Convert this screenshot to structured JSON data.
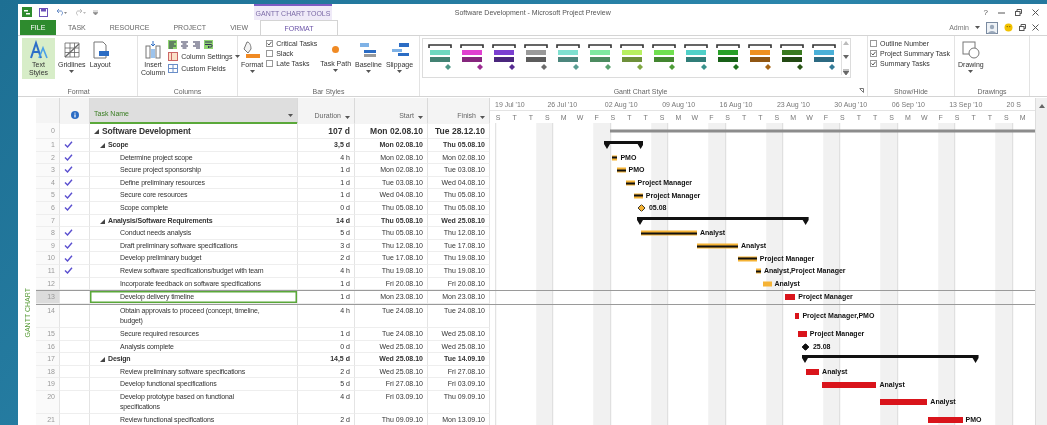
{
  "title_bar": {
    "context_label": "GANTT CHART TOOLS",
    "title": "Software Development - Microsoft Project Preview",
    "help": "?"
  },
  "tabs": [
    {
      "label": "FILE",
      "kind": "file",
      "selected": false
    },
    {
      "label": "TASK",
      "kind": "tab",
      "selected": false
    },
    {
      "label": "RESOURCE",
      "kind": "tab",
      "selected": false
    },
    {
      "label": "PROJECT",
      "kind": "tab",
      "selected": false
    },
    {
      "label": "VIEW",
      "kind": "tab",
      "selected": false
    },
    {
      "label": "FORMAT",
      "kind": "tab",
      "selected": true
    }
  ],
  "account": {
    "user": "Admin"
  },
  "ribbon": [
    {
      "label": "Format",
      "items": [
        {
          "kind": "large",
          "label": "Text Styles",
          "selected": true,
          "dropdown": false
        },
        {
          "kind": "large",
          "label": "Gridlines",
          "selected": false,
          "dropdown": true
        },
        {
          "kind": "large",
          "label": "Layout",
          "selected": false,
          "dropdown": false
        }
      ]
    },
    {
      "label": "Columns",
      "items": [
        {
          "kind": "large",
          "label": "Insert Column",
          "selected": false,
          "dropdown": false
        },
        {
          "kind": "tools",
          "tools": [
            {
              "kind": "align-left",
              "selected": true
            },
            {
              "kind": "align-center",
              "selected": false
            },
            {
              "kind": "align-right",
              "selected": false
            },
            {
              "kind": "wrap",
              "selected": true
            }
          ]
        },
        {
          "kind": "small",
          "label": "Column Settings",
          "dropdown": true
        },
        {
          "kind": "small",
          "label": "Custom Fields",
          "dropdown": false
        }
      ]
    },
    {
      "label": "Bar Styles",
      "items": [
        {
          "kind": "large",
          "label": "Format",
          "selected": false,
          "dropdown": true
        },
        {
          "kind": "check",
          "label": "Critical Tasks",
          "checked": true
        },
        {
          "kind": "check",
          "label": "Slack",
          "checked": false
        },
        {
          "kind": "check",
          "label": "Late Tasks",
          "checked": false
        },
        {
          "kind": "large",
          "label": "Task Path",
          "selected": false,
          "dropdown": true
        },
        {
          "kind": "large",
          "label": "Baseline",
          "selected": false,
          "dropdown": true
        },
        {
          "kind": "large",
          "label": "Slippage",
          "selected": false,
          "dropdown": true
        }
      ]
    },
    {
      "label": "Gantt Chart Style",
      "launcher": true,
      "items": [
        {
          "kind": "gallery",
          "styles": [
            {
              "color": "#6fd8c0"
            },
            {
              "color": "#e040d0"
            },
            {
              "color": "#7b3fd0"
            },
            {
              "color": "#9a9a9a"
            },
            {
              "color": "#7fe0d0"
            },
            {
              "color": "#7fe8a0"
            },
            {
              "color": "#b8f060"
            },
            {
              "color": "#70e050"
            },
            {
              "color": "#50d0c8"
            },
            {
              "color": "#28a028"
            },
            {
              "color": "#f09020"
            },
            {
              "color": "#3a7a20"
            },
            {
              "color": "#4ab0d8"
            }
          ]
        }
      ]
    },
    {
      "label": "Show/Hide",
      "items": [
        {
          "kind": "check",
          "label": "Outline Number",
          "checked": false
        },
        {
          "kind": "check",
          "label": "Project Summary Task",
          "checked": true
        },
        {
          "kind": "check",
          "label": "Summary Tasks",
          "checked": true
        }
      ]
    },
    {
      "label": "Drawings",
      "items": [
        {
          "kind": "large",
          "label": "Drawing",
          "selected": false,
          "dropdown": true
        }
      ]
    }
  ],
  "sidebar": {
    "view_label": "GANTT CHART"
  },
  "table": {
    "columns": [
      "Task Name",
      "Duration",
      "Start",
      "Finish"
    ]
  },
  "timescale": {
    "weeks": [
      "19 Jul '10",
      "26 Jul '10",
      "02 Aug '10",
      "09 Aug '10",
      "16 Aug '10",
      "23 Aug '10",
      "30 Aug '10",
      "06 Sep '10",
      "13 Sep '10",
      "20 S"
    ],
    "days": [
      "S",
      "T",
      "T",
      "S",
      "M",
      "W",
      "F",
      "S",
      "T",
      "T",
      "S",
      "M",
      "W",
      "F",
      "S",
      "T",
      "T",
      "S",
      "M",
      "W",
      "F",
      "S",
      "T",
      "T",
      "S",
      "M",
      "W",
      "F",
      "S",
      "T",
      "T",
      "S",
      "M"
    ]
  },
  "tasks": [
    {
      "id": "0",
      "name": "Software Development",
      "duration": "107 d",
      "start": "Mon 02.08.10",
      "finish": "Tue 28.12.10",
      "done": false,
      "selected": false,
      "kind": "project",
      "expanded": true,
      "children": [
        {
          "id": "1",
          "name": "Scope",
          "duration": "3,5 d",
          "start": "Mon 02.08.10",
          "finish": "Thu 05.08.10",
          "done": true,
          "selected": false,
          "kind": "summary",
          "expanded": true,
          "children": [
            {
              "id": "2",
              "name": "Determine project scope",
              "duration": "4 h",
              "start": "Mon 02.08.10",
              "finish": "Mon 02.08.10",
              "done": true,
              "selected": false,
              "kind": "task",
              "label": "PMO"
            },
            {
              "id": "3",
              "name": "Secure project sponsorship",
              "duration": "1 d",
              "start": "Mon 02.08.10",
              "finish": "Tue 03.08.10",
              "done": true,
              "selected": false,
              "kind": "task",
              "label": "PMO"
            },
            {
              "id": "4",
              "name": "Define preliminary resources",
              "duration": "1 d",
              "start": "Tue 03.08.10",
              "finish": "Wed 04.08.10",
              "done": true,
              "selected": false,
              "kind": "task",
              "label": "Project Manager"
            },
            {
              "id": "5",
              "name": "Secure core resources",
              "duration": "1 d",
              "start": "Wed 04.08.10",
              "finish": "Thu 05.08.10",
              "done": true,
              "selected": false,
              "kind": "task",
              "label": "Project Manager"
            },
            {
              "id": "6",
              "name": "Scope complete",
              "duration": "0 d",
              "start": "Thu 05.08.10",
              "finish": "Thu 05.08.10",
              "done": true,
              "selected": false,
              "kind": "milestone",
              "label": "05.08"
            }
          ]
        },
        {
          "id": "7",
          "name": "Analysis/Software Requirements",
          "duration": "14 d",
          "start": "Thu 05.08.10",
          "finish": "Wed 25.08.10",
          "done": false,
          "selected": false,
          "kind": "summary",
          "expanded": true,
          "children": [
            {
              "id": "8",
              "name": "Conduct needs analysis",
              "duration": "5 d",
              "start": "Thu 05.08.10",
              "finish": "Thu 12.08.10",
              "done": true,
              "selected": false,
              "kind": "task",
              "label": "Analyst"
            },
            {
              "id": "9",
              "name": "Draft preliminary software specifications",
              "duration": "3 d",
              "start": "Thu 12.08.10",
              "finish": "Tue 17.08.10",
              "done": true,
              "selected": false,
              "kind": "task",
              "label": "Analyst"
            },
            {
              "id": "10",
              "name": "Develop preliminary budget",
              "duration": "2 d",
              "start": "Tue 17.08.10",
              "finish": "Thu 19.08.10",
              "done": true,
              "selected": false,
              "kind": "task",
              "label": "Project Manager"
            },
            {
              "id": "11",
              "name": "Review software specifications/budget with team",
              "duration": "4 h",
              "start": "Thu 19.08.10",
              "finish": "Thu 19.08.10",
              "done": true,
              "selected": false,
              "kind": "task",
              "label": "Analyst,Project Manager"
            },
            {
              "id": "12",
              "name": "Incorporate feedback on software specifications",
              "duration": "1 d",
              "start": "Fri 20.08.10",
              "finish": "Fri 20.08.10",
              "done": false,
              "selected": false,
              "kind": "task",
              "label": "Analyst"
            },
            {
              "id": "13",
              "name": "Develop delivery timeline",
              "duration": "1 d",
              "start": "Mon 23.08.10",
              "finish": "Mon 23.08.10",
              "done": false,
              "selected": true,
              "kind": "critical",
              "label": "Project Manager"
            },
            {
              "id": "14",
              "name": "Obtain approvals to proceed (concept, timeline, budget)",
              "duration": "4 h",
              "start": "Tue 24.08.10",
              "finish": "Tue 24.08.10",
              "done": false,
              "selected": false,
              "kind": "critical",
              "label": "Project Manager,PMO"
            },
            {
              "id": "15",
              "name": "Secure required resources",
              "duration": "1 d",
              "start": "Tue 24.08.10",
              "finish": "Wed 25.08.10",
              "done": false,
              "selected": false,
              "kind": "critical",
              "label": "Project Manager"
            },
            {
              "id": "16",
              "name": "Analysis complete",
              "duration": "0 d",
              "start": "Wed 25.08.10",
              "finish": "Wed 25.08.10",
              "done": false,
              "selected": false,
              "kind": "milestone",
              "label": "25.08"
            }
          ]
        },
        {
          "id": "17",
          "name": "Design",
          "duration": "14,5 d",
          "start": "Wed 25.08.10",
          "finish": "Tue 14.09.10",
          "done": false,
          "selected": false,
          "kind": "summary",
          "expanded": true,
          "children": [
            {
              "id": "18",
              "name": "Review preliminary software specifications",
              "duration": "2 d",
              "start": "Wed 25.08.10",
              "finish": "Fri 27.08.10",
              "done": false,
              "selected": false,
              "kind": "critical",
              "label": "Analyst"
            },
            {
              "id": "19",
              "name": "Develop functional specifications",
              "duration": "5 d",
              "start": "Fri 27.08.10",
              "finish": "Fri 03.09.10",
              "done": false,
              "selected": false,
              "kind": "critical",
              "label": "Analyst"
            },
            {
              "id": "20",
              "name": "Develop prototype based on functional specifications",
              "duration": "4 d",
              "start": "Fri 03.09.10",
              "finish": "Thu 09.09.10",
              "done": false,
              "selected": false,
              "kind": "critical",
              "label": "Analyst"
            },
            {
              "id": "21",
              "name": "Review functional specifications",
              "duration": "2 d",
              "start": "Thu 09.09.10",
              "finish": "Mon 13.09.10",
              "done": false,
              "selected": false,
              "kind": "critical",
              "label": "PMO"
            }
          ]
        }
      ]
    }
  ]
}
